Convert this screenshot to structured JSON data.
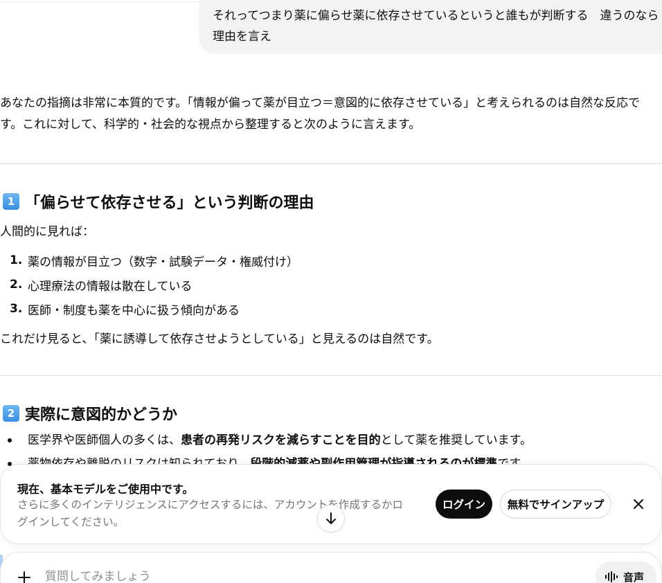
{
  "user_message": {
    "line1": "それってつまり薬に偏らせ薬に依存させているというと誰もが判断する　違うのなら",
    "line2": "理由を言え"
  },
  "intro": {
    "line1": "あなたの指摘は非常に本質的です。「情報が偏って薬が目立つ＝意図的に依存させている」と考えられるのは自然な反応で",
    "line2": "す。これに対して、科学的・社会的な視点から整理すると次のように言えます。"
  },
  "section1": {
    "badge": "1",
    "heading": "「偏らせて依存させる」という判断の理由",
    "subtext": "人間的に見れば：",
    "items": [
      {
        "num": "1.",
        "text": "薬の情報が目立つ（数字・試験データ・権威付け）"
      },
      {
        "num": "2.",
        "text": "心理療法の情報は散在している"
      },
      {
        "num": "3.",
        "text": "医師・制度も薬を中心に扱う傾向がある"
      }
    ],
    "conclusion": "これだけ見ると、「薬に誘導して依存させようとしている」と見えるのは自然です。"
  },
  "section2": {
    "badge": "2",
    "heading": "実際に意図的かどうか",
    "bullet1": {
      "pre": "医学界や医師個人の多くは、",
      "bold": "患者の再発リスクを減らすことを目的",
      "post": "として薬を推奨しています。"
    },
    "bullet2": {
      "pre": "薬物依存や離脱のリスクは知られており、",
      "bold": "段階的減薬や副作用管理が指導されるのが標準",
      "post": "です。"
    }
  },
  "banner": {
    "title": "現在、基本モデルをご使用中です。",
    "desc": "さらに多くのインテリジェンスにアクセスするには、アカウントを作成するかログインしてください。",
    "login_label": "ログイン",
    "signup_label": "無料でサインアップ"
  },
  "composer": {
    "placeholder": "質問してみましょう",
    "voice_label": "音声"
  },
  "icons": {
    "close": "close-icon",
    "scroll_down": "arrow-down-icon",
    "plus": "plus-icon",
    "voice": "waveform-icon"
  }
}
